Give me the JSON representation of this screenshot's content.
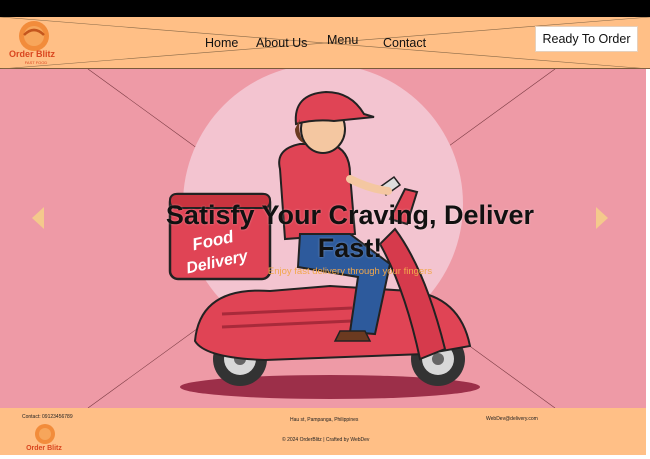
{
  "brand": {
    "logo_text": "Order Blitz",
    "logo_tagline": "FAST FOOD",
    "primary_color": "#ffbf86",
    "hero_color": "#ee9aa6",
    "accent_color": "#f2a84c"
  },
  "nav": {
    "items": [
      {
        "label": "Home"
      },
      {
        "label": "About Us"
      },
      {
        "label": "Menu"
      },
      {
        "label": "Contact"
      }
    ],
    "cta_label": "Ready To Order"
  },
  "hero": {
    "headline": "Satisfy Your Craving, Deliver Fast!",
    "subline": "Enjoy fast delivery through your fingers",
    "box_text": "Food Delivery",
    "prev_icon": "chevron-left-icon",
    "next_icon": "chevron-right-icon"
  },
  "footer": {
    "contact": "Contact: 09123456789",
    "address": "Hau st, Pampanga, Philippines",
    "email": "WebDev@delivery.com",
    "copyright": "© 2024 OrderBlitz | Crafted by WebDev"
  }
}
